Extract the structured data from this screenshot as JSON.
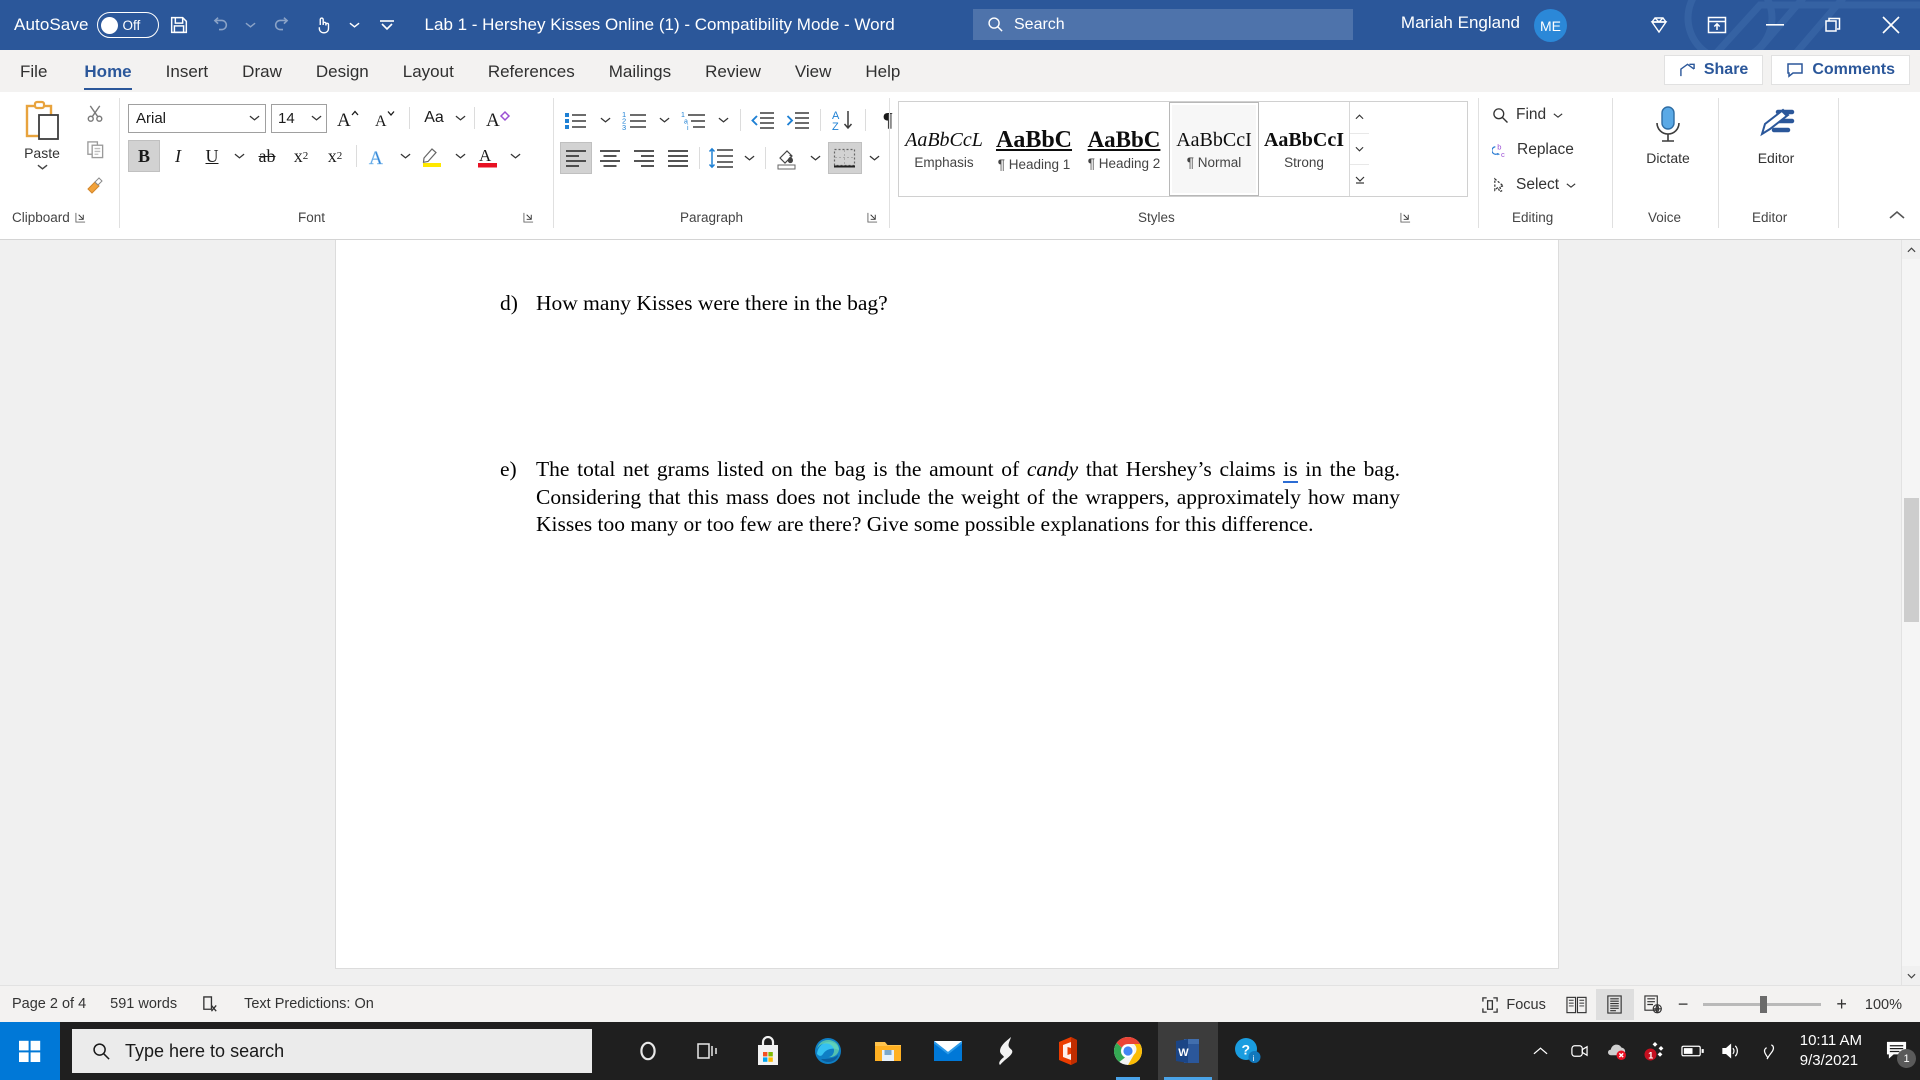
{
  "titlebar": {
    "autosave_label": "AutoSave",
    "autosave_state": "Off",
    "document_title": "Lab 1 - Hershey Kisses Online (1)  -  Compatibility Mode  -  Word",
    "search_placeholder": "Search",
    "user_name": "Mariah England",
    "user_initials": "ME",
    "icons": {
      "save": "save-icon",
      "undo": "undo-icon",
      "redo": "redo-icon",
      "touch_mode": "touch-mode-icon",
      "customize_qat": "customize-quick-access-toolbar-icon",
      "office_diamond": "office-premium-diamond-icon",
      "ribbon_display": "ribbon-display-options-icon",
      "minimize": "minimize-icon",
      "restore": "restore-icon",
      "close": "close-icon"
    }
  },
  "tabs": [
    {
      "label": "File",
      "active": false
    },
    {
      "label": "Home",
      "active": true
    },
    {
      "label": "Insert",
      "active": false
    },
    {
      "label": "Draw",
      "active": false
    },
    {
      "label": "Design",
      "active": false
    },
    {
      "label": "Layout",
      "active": false
    },
    {
      "label": "References",
      "active": false
    },
    {
      "label": "Mailings",
      "active": false
    },
    {
      "label": "Review",
      "active": false
    },
    {
      "label": "View",
      "active": false
    },
    {
      "label": "Help",
      "active": false
    }
  ],
  "tabstrip_right": {
    "share_label": "Share",
    "comments_label": "Comments"
  },
  "ribbon": {
    "groups": [
      {
        "name": "Clipboard",
        "label": "Clipboard",
        "has_launcher": true
      },
      {
        "name": "Font",
        "label": "Font",
        "has_launcher": true
      },
      {
        "name": "Paragraph",
        "label": "Paragraph",
        "has_launcher": true
      },
      {
        "name": "Styles",
        "label": "Styles",
        "has_launcher": true
      },
      {
        "name": "Editing",
        "label": "Editing",
        "has_launcher": false
      },
      {
        "name": "Voice",
        "label": "Voice",
        "has_launcher": false
      },
      {
        "name": "Editor",
        "label": "Editor",
        "has_launcher": false
      }
    ],
    "clipboard": {
      "paste_label": "Paste",
      "cut_name": "cut-icon",
      "copy_name": "copy-icon",
      "format_painter_name": "format-painter-icon"
    },
    "font": {
      "font_name_value": "Arial",
      "font_size_value": "14",
      "grow_font": "A",
      "shrink_font": "A",
      "change_case": "Aa",
      "clear_formatting": "A",
      "bold": "B",
      "italic": "I",
      "underline": "U",
      "strikethrough": "ab",
      "subscript": "x",
      "superscript": "x",
      "text_effects": "A",
      "highlight": "A",
      "font_color": "A",
      "bold_active": true
    },
    "paragraph": {
      "bullets": "bullet-list-icon",
      "numbering": "numbered-list-icon",
      "multilevel": "multilevel-list-icon",
      "decrease_indent": "decrease-indent-icon",
      "increase_indent": "increase-indent-icon",
      "sort": "sort-icon",
      "show_marks": "¶",
      "align_left": "align-left-icon",
      "align_center": "align-center-icon",
      "align_right": "align-right-icon",
      "justify": "justify-icon",
      "line_spacing": "line-spacing-icon",
      "shading": "shading-icon",
      "borders": "borders-icon",
      "align_left_active": true
    },
    "styles": [
      {
        "preview": "AaBbCcL",
        "name": "Emphasis",
        "selected": false,
        "style": "italic-serif"
      },
      {
        "preview": "AaBbC",
        "name": "¶ Heading 1",
        "selected": false,
        "style": "bold-underline"
      },
      {
        "preview": "AaBbC",
        "name": "¶ Heading 2",
        "selected": false,
        "style": "bold-underline"
      },
      {
        "preview": "AaBbCcI",
        "name": "¶ Normal",
        "selected": true,
        "style": "plain"
      },
      {
        "preview": "AaBbCcI",
        "name": "Strong",
        "selected": false,
        "style": "bold"
      }
    ],
    "editing": {
      "find_label": "Find",
      "replace_label": "Replace",
      "select_label": "Select"
    },
    "voice": {
      "dictate_label": "Dictate"
    },
    "editor_group": {
      "editor_label": "Editor"
    },
    "collapse_ribbon": "collapse-ribbon-icon"
  },
  "document": {
    "items": [
      {
        "marker": "d)",
        "text": "How many Kisses were there in the bag?",
        "justify": false
      },
      {
        "marker": "e)",
        "text_before_italic": "The total net grams listed on the bag is the amount of ",
        "italic_word": "candy",
        "text_middle": " that Hershey’s claims ",
        "grammar_word": "is",
        "text_after": " in the bag. Considering that this mass does not include the weight of the wrappers, approximately how many Kisses too many or too few are there? Give some possible explanations for this difference.",
        "justify": true
      }
    ]
  },
  "statusbar": {
    "page_label": "Page 2 of 4",
    "word_count": "591 words",
    "proofing_icon": "proofing-errors-icon",
    "text_predictions": "Text Predictions: On",
    "focus_label": "Focus",
    "read_mode": "read-mode-icon",
    "print_layout": "print-layout-icon",
    "web_layout": "web-layout-icon",
    "zoom_out": "−",
    "zoom_in": "+",
    "zoom_level": "100%"
  },
  "taskbar": {
    "start": "windows-start-icon",
    "search_placeholder": "Type here to search",
    "apps": [
      {
        "name": "cortana-icon",
        "active": false,
        "running": false
      },
      {
        "name": "task-view-icon",
        "active": false,
        "running": false
      },
      {
        "name": "microsoft-store-icon",
        "active": false,
        "running": false
      },
      {
        "name": "microsoft-edge-icon",
        "active": false,
        "running": false
      },
      {
        "name": "file-explorer-icon",
        "active": false,
        "running": false
      },
      {
        "name": "mail-icon",
        "active": false,
        "running": false
      },
      {
        "name": "lightning-app-icon",
        "active": false,
        "running": false
      },
      {
        "name": "microsoft-office-icon",
        "active": false,
        "running": false
      },
      {
        "name": "google-chrome-icon",
        "active": false,
        "running": true
      },
      {
        "name": "microsoft-word-icon",
        "active": true,
        "running": true
      },
      {
        "name": "help-support-icon",
        "active": false,
        "running": false
      }
    ],
    "tray": {
      "show_hidden": "chevron-up-icon",
      "camera": "camera-icon",
      "onedrive": "onedrive-error-icon",
      "updates": "updates-badge-icon",
      "updates_count": "1",
      "battery": "battery-icon",
      "volume": "volume-icon",
      "pen": "pen-icon",
      "time": "10:11 AM",
      "date": "9/3/2021",
      "notifications": "notifications-icon",
      "notification_count": "1"
    }
  },
  "colors": {
    "word_blue": "#2b579a",
    "accent_blue": "#2b88d8",
    "ribbon_bg": "#ffffff",
    "tabstrip_bg": "#f3f2f1",
    "doc_bg": "#f0f0f0",
    "taskbar_bg": "#1f1f1f"
  }
}
